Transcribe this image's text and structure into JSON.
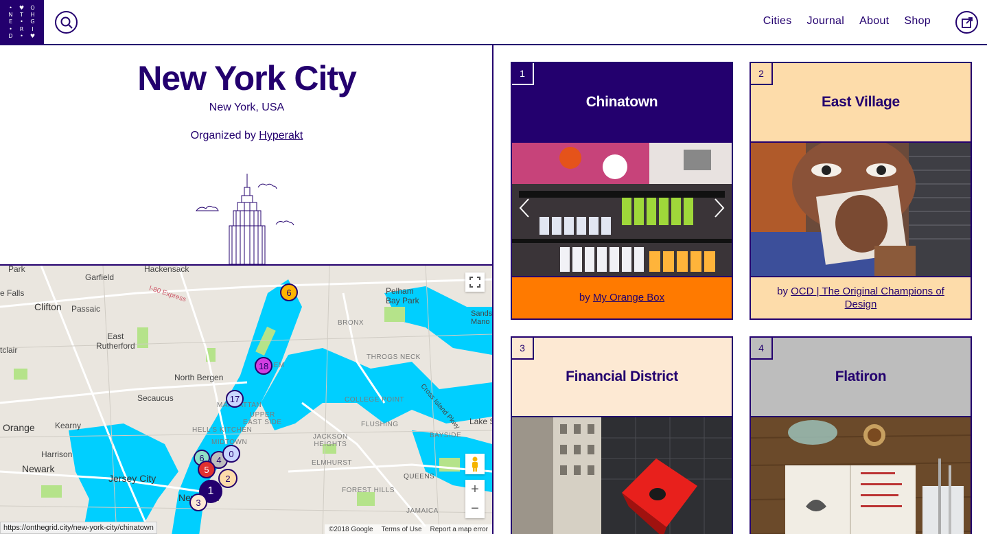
{
  "brand": {
    "logo_letters": [
      "•",
      "♥",
      "O",
      "N",
      "T",
      "H",
      "E",
      "•",
      "G",
      "•",
      "R",
      "I",
      "D",
      "•",
      "♥"
    ]
  },
  "nav": {
    "items": [
      "Cities",
      "Journal",
      "About",
      "Shop"
    ]
  },
  "city": {
    "title": "New York City",
    "subtitle": "New York, USA",
    "organized_prefix": "Organized by",
    "organizer": "Hyperakt"
  },
  "map": {
    "labels": {
      "park": "Park",
      "hackensack": "Hackensack",
      "garfield": "Garfield",
      "falls": "e Falls",
      "clifton": "Clifton",
      "passaic": "Passaic",
      "east_rutherford": "East\nRutherford",
      "clair": "tclair",
      "north_bergen": "North Bergen",
      "secaucus": "Secaucus",
      "orange": "Orange",
      "kearny": "Kearny",
      "harrison": "Harrison",
      "newark": "Newark",
      "jersey_city": "Jersey City",
      "manhattan": "MANHATTAN",
      "upper_east": "UPPER\nEAST SIDE",
      "hells_kitchen": "HELL'S KITCHEN",
      "midtown": "MIDTOWN",
      "new_york": "New York",
      "harlem": "HARLEM",
      "bronx": "BRONX",
      "pelham": "Pelham\nBay Park",
      "throgs": "THROGS NECK",
      "college_point": "COLLEGE POINT",
      "flushing": "FLUSHING",
      "bayside": "BAYSIDE",
      "jackson": "JACKSON\nHEIGHTS",
      "elmhurst": "ELMHURST",
      "forest_hills": "FOREST HILLS",
      "queens": "QUEENS",
      "jamaica": "JAMAICA",
      "lake": "Lake S",
      "cross_island": "Cross Island Pkwy",
      "sands": "Sands\nMano",
      "express": "I-80 Express"
    },
    "markers": [
      "6",
      "18",
      "17",
      "4",
      "0",
      "6",
      "5",
      "2",
      "1",
      "3"
    ],
    "footer": {
      "copyright": "©2018 Google",
      "terms": "Terms of Use",
      "report": "Report a map error"
    },
    "status_url": "https://onthegrid.city/new-york-city/chinatown",
    "zoom_in": "+",
    "zoom_out": "−"
  },
  "cards": [
    {
      "num": "1",
      "title": "Chinatown",
      "by_prefix": "by",
      "author": "My Orange Box"
    },
    {
      "num": "2",
      "title": "East Village",
      "by_prefix": "by",
      "author": "OCD | The Original Champions of Design"
    },
    {
      "num": "3",
      "title": "Financial District"
    },
    {
      "num": "4",
      "title": "Flatiron"
    }
  ],
  "colors": {
    "brand": "#23006e",
    "orange": "#ff7a00",
    "peach": "#fddcaa",
    "cream": "#fde9d3",
    "gray": "#bdbdbd",
    "water": "#00cfff"
  }
}
